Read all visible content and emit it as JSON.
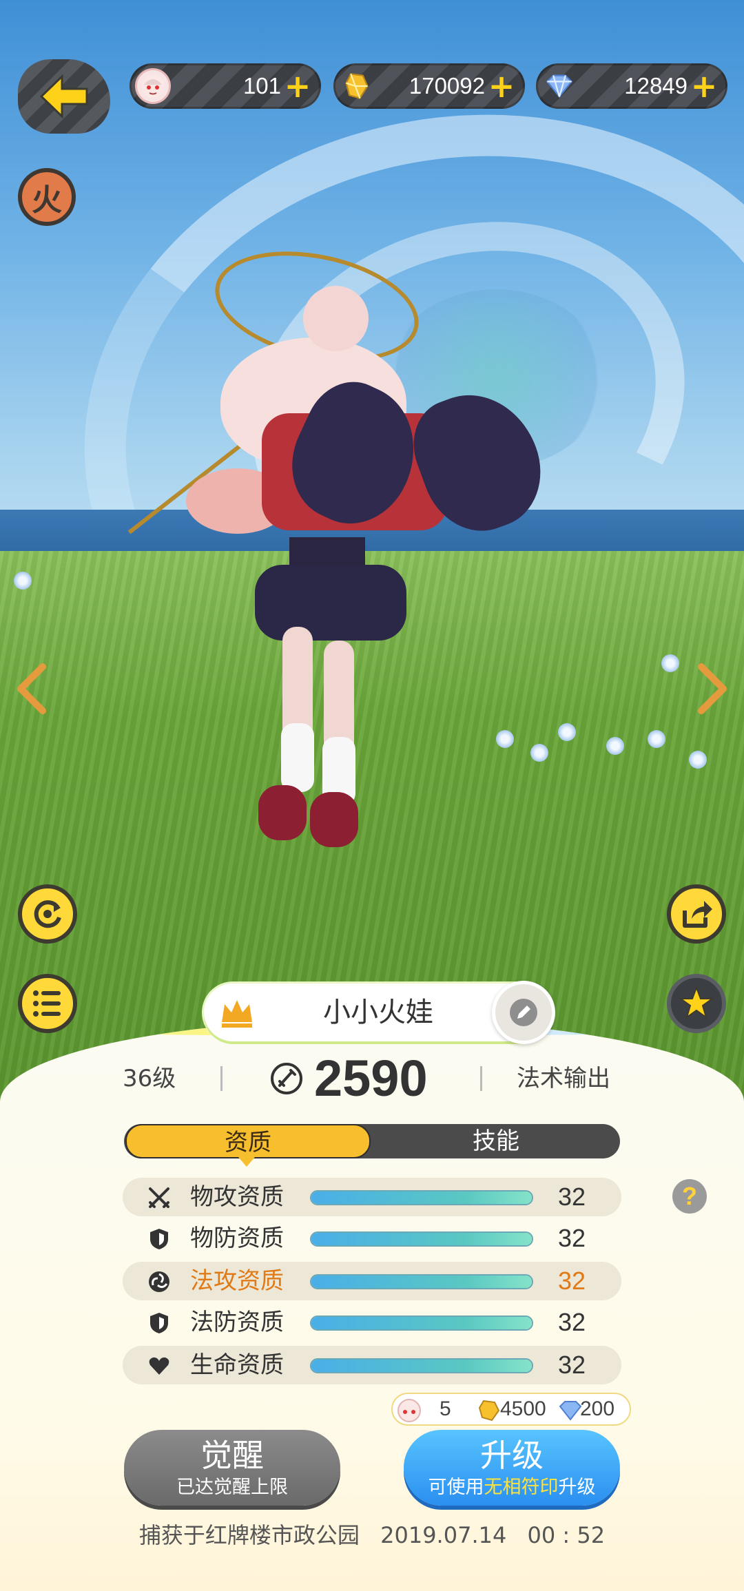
{
  "resources": [
    {
      "icon": "pet-face-icon",
      "value": "101"
    },
    {
      "icon": "gold-crystal-icon",
      "value": "170092"
    },
    {
      "icon": "diamond-icon",
      "value": "12849"
    }
  ],
  "element_badge": "火",
  "pet": {
    "name": "小小火娃",
    "level": "36级",
    "power": "2590",
    "role": "法术输出"
  },
  "tabs": {
    "active": "资质",
    "inactive": "技能"
  },
  "attributes": [
    {
      "icon": "swords-icon",
      "label": "物攻资质",
      "value": "32",
      "fill": 1.0
    },
    {
      "icon": "shield-icon",
      "label": "物防资质",
      "value": "32",
      "fill": 1.0
    },
    {
      "icon": "magic-swirl-icon",
      "label": "法攻资质",
      "value": "32",
      "fill": 1.0
    },
    {
      "icon": "shield-icon",
      "label": "法防资质",
      "value": "32",
      "fill": 1.0
    },
    {
      "icon": "heart-icon",
      "label": "生命资质",
      "value": "32",
      "fill": 1.0
    }
  ],
  "cost": {
    "pet": "5",
    "gold": "4500",
    "diamond": "200"
  },
  "awaken": {
    "title": "觉醒",
    "subtitle": "已达觉醒上限"
  },
  "upgrade": {
    "title": "升级",
    "subtitle_pre": "可使用",
    "subtitle_hl": "无相符印",
    "subtitle_post": "升级"
  },
  "footer": {
    "place": "捕获于红牌楼市政公园",
    "date": "2019.07.14",
    "time": "00 : 52"
  },
  "colors": {
    "accent_yellow": "#ffd21a",
    "tab_active": "#f7be2e",
    "highlight_orange": "#e07a17",
    "upgrade_blue": "#2a8ff0"
  }
}
